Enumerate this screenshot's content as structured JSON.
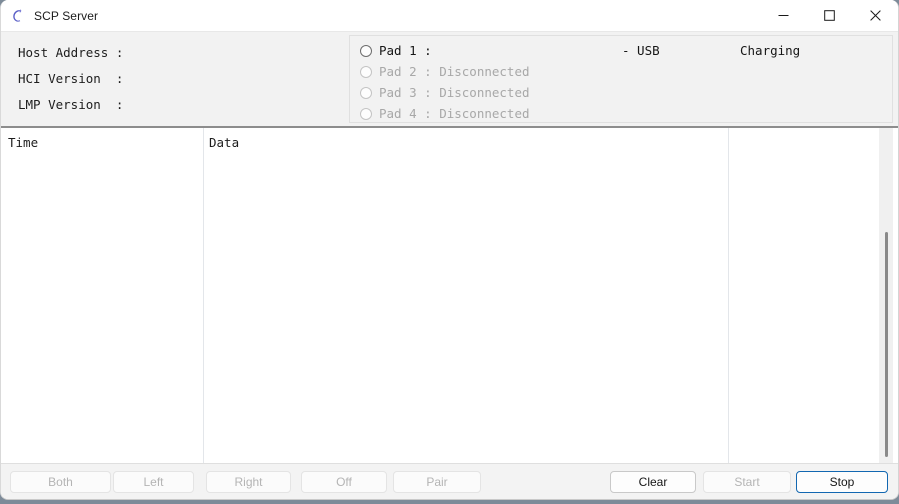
{
  "window": {
    "title": "SCP Server",
    "icon": "scp-server-icon",
    "controls": {
      "minimize": "—",
      "maximize": "□",
      "close": "✕"
    }
  },
  "accent_colors": {
    "focus_border": "#1267b1",
    "title_icon": "#5a5fc7",
    "disabled_text": "#b4b4b4",
    "panel_bg": "#f2f2f2",
    "divider": "#8d8d8d"
  },
  "host_info": {
    "rows": [
      {
        "label": "Host Address :",
        "value": ""
      },
      {
        "label": "HCI Version  :",
        "value": ""
      },
      {
        "label": "LMP Version  :",
        "value": ""
      }
    ]
  },
  "pads": {
    "items": [
      {
        "label": "Pad 1 :",
        "status": "",
        "connection": "- USB",
        "battery": "Charging",
        "connected": true,
        "selected": false
      },
      {
        "label": "Pad 2 : Disconnected",
        "status": "Disconnected",
        "connection": "",
        "battery": "",
        "connected": false,
        "selected": false
      },
      {
        "label": "Pad 3 : Disconnected",
        "status": "Disconnected",
        "connection": "",
        "battery": "",
        "connected": false,
        "selected": false
      },
      {
        "label": "Pad 4 : Disconnected",
        "status": "Disconnected",
        "connection": "",
        "battery": "",
        "connected": false,
        "selected": false
      }
    ]
  },
  "log": {
    "columns": [
      "Time",
      "Data"
    ],
    "rows": []
  },
  "toolbar": {
    "both_label": "Both",
    "left_label": "Left",
    "right_label": "Right",
    "off_label": "Off",
    "pair_label": "Pair",
    "clear_label": "Clear",
    "start_label": "Start",
    "stop_label": "Stop"
  }
}
